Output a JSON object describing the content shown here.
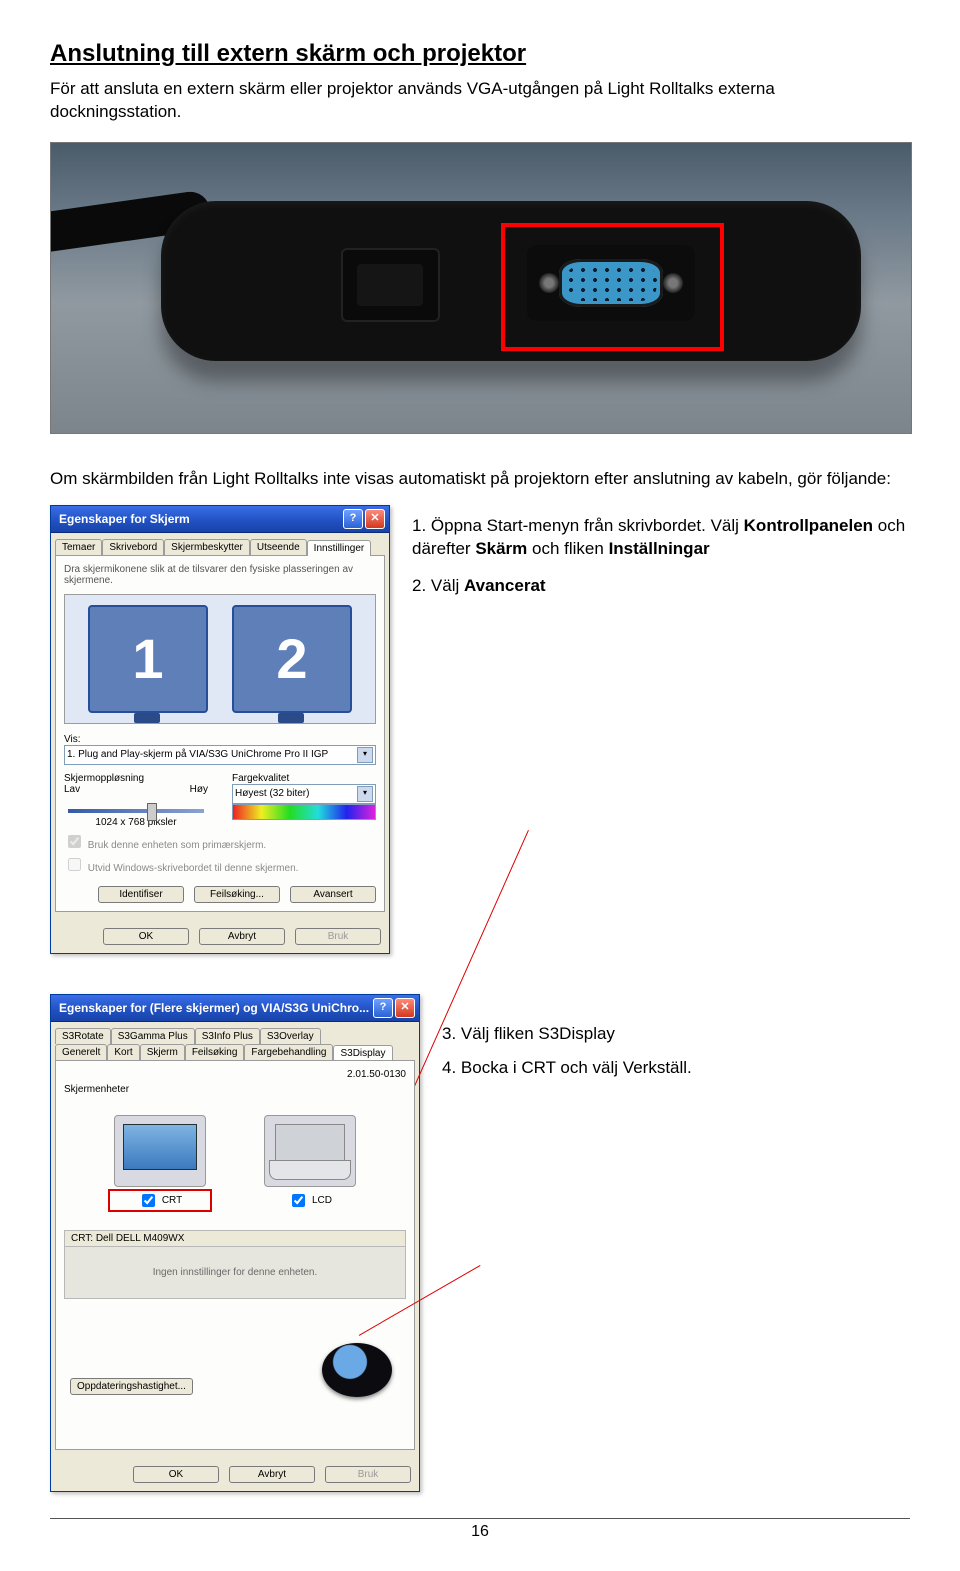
{
  "title": "Anslutning till extern skärm och projektor",
  "intro": "För att ansluta en extern skärm eller projektor används VGA-utgången på Light Rolltalks externa dockningsstation.",
  "sub_intro": "Om skärmbilden från Light Rolltalks inte visas automatiskt på projektorn efter anslutning av kabeln, gör följande:",
  "instructions": {
    "i1_pre": "1. Öppna Start-menyn från skrivbordet. Välj ",
    "i1_b1": "Kontrollpanelen",
    "i1_mid1": " och därefter ",
    "i1_b2": "Skärm",
    "i1_mid2": " och fliken ",
    "i1_b3": "Inställningar",
    "i2_pre": "2. Välj ",
    "i2_b1": "Avancerat"
  },
  "lower_instructions": {
    "i3_pre": "3. Välj fliken ",
    "i3_b1": "S3Display",
    "i4_pre": "4. Bocka i ",
    "i4_b1": "CRT",
    "i4_mid": " och välj ",
    "i4_b2": "Verkställ."
  },
  "win1": {
    "title": "Egenskaper for Skjerm",
    "help": "?",
    "close": "✕",
    "tabs": [
      "Temaer",
      "Skrivebord",
      "Skjermbeskytter",
      "Utseende",
      "Innstillinger"
    ],
    "note": "Dra skjermikonene slik at de tilsvarer den fysiske plasseringen av skjermene.",
    "mon1": "1",
    "mon2": "2",
    "vis_label": "Vis:",
    "vis_value": "1. Plug and Play-skjerm på VIA/S3G UniChrome Pro II IGP",
    "res_label": "Skjermoppløsning",
    "res_low": "Lav",
    "res_high": "Høy",
    "res_value": "1024 x 768 piksler",
    "color_label": "Fargekvalitet",
    "color_value": "Høyest (32 biter)",
    "chk1": "Bruk denne enheten som primærskjerm.",
    "chk2": "Utvid Windows-skrivebordet til denne skjermen.",
    "btn_ident": "Identifiser",
    "btn_feil": "Feilsøking...",
    "btn_adv": "Avansert",
    "btn_ok": "OK",
    "btn_cancel": "Avbryt",
    "btn_apply": "Bruk"
  },
  "win2": {
    "title": "Egenskaper for (Flere skjermer) og VIA/S3G UniChro...",
    "help": "?",
    "close": "✕",
    "tabs_row1": [
      "S3Rotate",
      "S3Gamma Plus",
      "S3Info Plus",
      "S3Overlay"
    ],
    "tabs_row2": [
      "Generelt",
      "Kort",
      "Skjerm",
      "Feilsøking",
      "Fargebehandling",
      "S3Display"
    ],
    "version": "2.01.50-0130",
    "section": "Skjermenheter",
    "crt": "CRT",
    "lcd": "LCD",
    "crt_header": "CRT: Dell DELL M409WX",
    "crt_body": "Ingen innstillinger for denne enheten.",
    "btn_oppd": "Oppdateringshastighet...",
    "btn_ok": "OK",
    "btn_cancel": "Avbryt",
    "btn_apply": "Bruk"
  },
  "page_number": "16"
}
